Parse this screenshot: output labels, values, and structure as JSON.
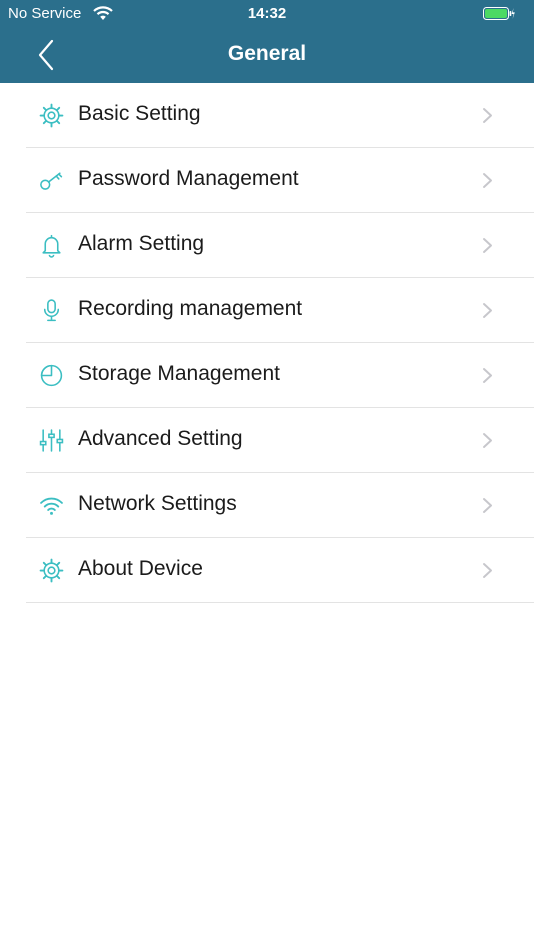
{
  "status_bar": {
    "carrier": "No Service",
    "time": "14:32",
    "battery_color": "#4cd964"
  },
  "nav": {
    "title": "General"
  },
  "colors": {
    "header": "#2b6f8c",
    "icon_accent": "#3bbec2",
    "chevron": "#c7c7cc"
  },
  "menu": {
    "items": [
      {
        "label": "Basic Setting",
        "icon": "gear-icon"
      },
      {
        "label": "Password Management",
        "icon": "key-icon"
      },
      {
        "label": "Alarm Setting",
        "icon": "bell-icon"
      },
      {
        "label": "Recording management",
        "icon": "microphone-icon"
      },
      {
        "label": "Storage Management",
        "icon": "pie-chart-icon"
      },
      {
        "label": "Advanced Setting",
        "icon": "sliders-icon"
      },
      {
        "label": "Network Settings",
        "icon": "wifi-icon"
      },
      {
        "label": "About Device",
        "icon": "gear-icon"
      }
    ]
  }
}
